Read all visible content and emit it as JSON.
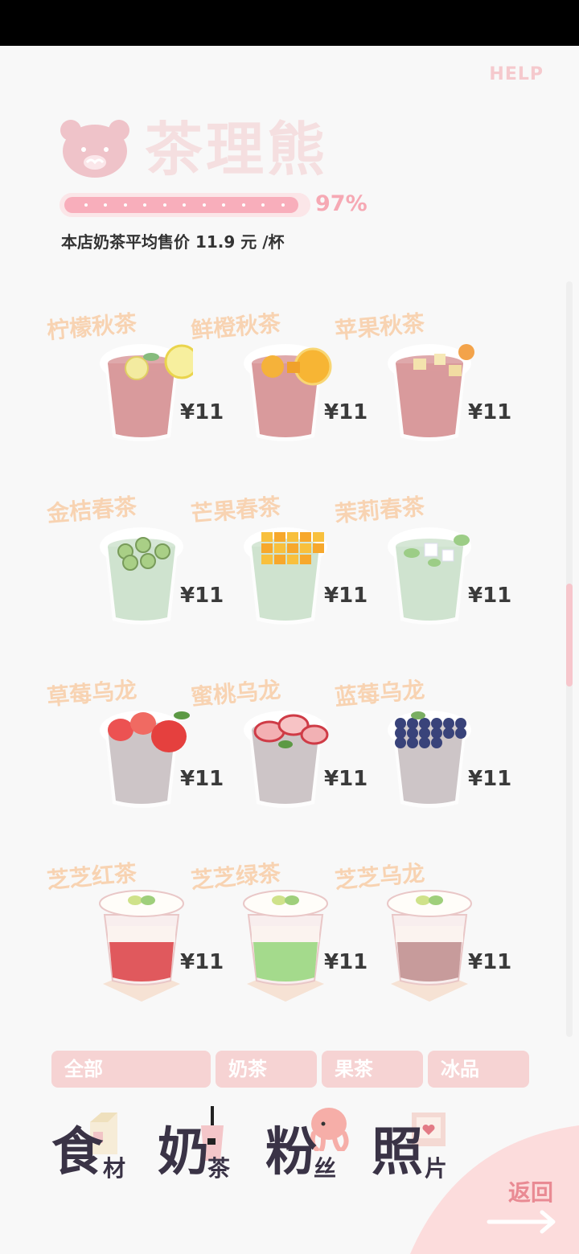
{
  "header": {
    "help_label": "HELP",
    "shop_name": "茶理熊",
    "progress_percent": 97,
    "progress_label": "97%",
    "avg_price_text": "本店奶茶平均售价 11.9 元 /杯"
  },
  "scroll": {
    "thumb_fraction_start": 0.4
  },
  "menu": {
    "rows": [
      {
        "items": [
          {
            "name": "柠檬秋茶",
            "price": "¥11",
            "cup": "hot",
            "liquid": "#d99a9c",
            "topping": "lemon"
          },
          {
            "name": "鲜橙秋茶",
            "price": "¥11",
            "cup": "hot",
            "liquid": "#d99a9c",
            "topping": "orange"
          },
          {
            "name": "苹果秋茶",
            "price": "¥11",
            "cup": "hot",
            "liquid": "#d99a9c",
            "topping": "apple"
          }
        ]
      },
      {
        "items": [
          {
            "name": "金桔春茶",
            "price": "¥11",
            "cup": "hot",
            "liquid": "#cfe3cf",
            "topping": "kumquat"
          },
          {
            "name": "芒果春茶",
            "price": "¥11",
            "cup": "hot",
            "liquid": "#cfe3cf",
            "topping": "mango"
          },
          {
            "name": "茉莉春茶",
            "price": "¥11",
            "cup": "hot",
            "liquid": "#cfe3cf",
            "topping": "jasmine"
          }
        ]
      },
      {
        "items": [
          {
            "name": "草莓乌龙",
            "price": "¥11",
            "cup": "hot",
            "liquid": "#cdc5c7",
            "topping": "strawberry"
          },
          {
            "name": "蜜桃乌龙",
            "price": "¥11",
            "cup": "hot",
            "liquid": "#cdc5c7",
            "topping": "peach"
          },
          {
            "name": "蓝莓乌龙",
            "price": "¥11",
            "cup": "hot",
            "liquid": "#cdc5c7",
            "topping": "blueberry"
          }
        ]
      },
      {
        "items": [
          {
            "name": "芝芝红茶",
            "price": "¥11",
            "cup": "cold",
            "liquid": "#e0595d",
            "topping": "cheese"
          },
          {
            "name": "芝芝绿茶",
            "price": "¥11",
            "cup": "cold",
            "liquid": "#a4da8c",
            "topping": "cheese"
          },
          {
            "name": "芝芝乌龙",
            "price": "¥11",
            "cup": "cold",
            "liquid": "#c79b9b",
            "topping": "cheese"
          }
        ]
      }
    ]
  },
  "filters": [
    {
      "label": "全部"
    },
    {
      "label": "奶茶"
    },
    {
      "label": "果茶"
    },
    {
      "label": "冰品"
    }
  ],
  "nav": [
    {
      "big": "食",
      "small": "材",
      "icon": "milk-carton-icon"
    },
    {
      "big": "奶",
      "small": "茶",
      "icon": "milk-tea-cup-icon"
    },
    {
      "big": "粉",
      "small": "丝",
      "icon": "octopus-icon"
    },
    {
      "big": "照",
      "small": "片",
      "icon": "photo-frame-icon"
    }
  ],
  "back_label": "返回",
  "colors": {
    "accent_pink": "#f6a9b4",
    "label_peach": "#f8cfab",
    "title_faded": "#f5dfe0",
    "nav_dark": "#3a3346"
  }
}
